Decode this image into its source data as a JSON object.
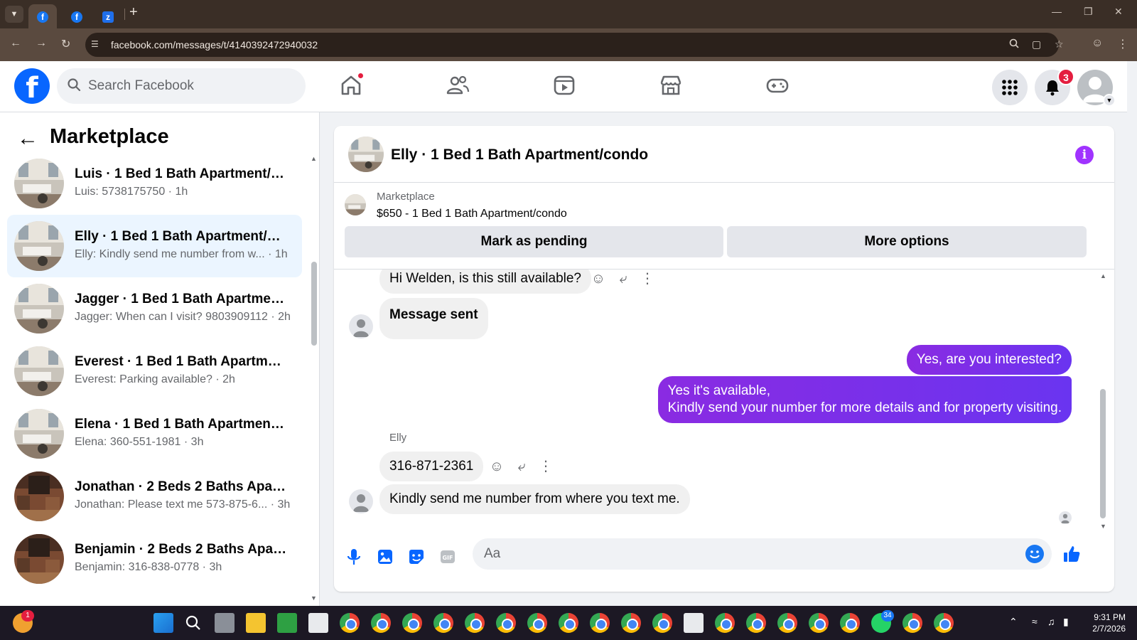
{
  "browser": {
    "url": "facebook.com/messages/t/4140392472940032"
  },
  "header": {
    "search_placeholder": "Search Facebook",
    "notification_count": "3"
  },
  "sidebar": {
    "title": "Marketplace",
    "conversations": [
      {
        "title": "Luis · 1 Bed 1 Bath Apartment/co...",
        "subtitle": "Luis: 5738175750 · 1h"
      },
      {
        "title": "Elly · 1 Bed 1 Bath Apartment/co...",
        "subtitle": "Elly: Kindly send me number from w... · 1h"
      },
      {
        "title": "Jagger · 1 Bed 1 Bath Apartment/...",
        "subtitle": "Jagger: When can I visit? 9803909112 · 2h"
      },
      {
        "title": "Everest · 1 Bed 1 Bath Apartment...",
        "subtitle": "Everest: Parking available? · 2h"
      },
      {
        "title": "Elena · 1 Bed 1 Bath Apartment/c...",
        "subtitle": "Elena: 360-551-1981 · 3h"
      },
      {
        "title": "Jonathan · 2 Beds 2 Baths Apart...",
        "subtitle": "Jonathan: Please text me 573-875-6... · 3h"
      },
      {
        "title": "Benjamin · 2 Beds 2 Baths Apart...",
        "subtitle": "Benjamin: 316-838-0778 · 3h"
      }
    ]
  },
  "chat": {
    "title": "Elly · 1 Bed 1 Bath Apartment/condo",
    "listing_source": "Marketplace",
    "listing_title": "$650 - 1 Bed 1 Bath Apartment/condo",
    "mark_pending_label": "Mark as pending",
    "more_options_label": "More options",
    "messages": {
      "m1": "Hi Welden, is this still available?",
      "m2": "Message sent",
      "m3": "Yes, are you interested?",
      "m4_line1": "Yes it's available,",
      "m4_line2": "Kindly send your number for more details and for property visiting.",
      "sender": "Elly",
      "m5": "316-871-2361",
      "m6": "Kindly send me number from where you text me."
    },
    "composer_placeholder": "Aa"
  },
  "taskbar": {
    "time": "9:31 PM",
    "date": "2/7/2026",
    "whatsapp_badge": "34",
    "weather_badge": "1"
  },
  "colors": {
    "facebook_blue": "#0866ff",
    "outgoing_bubble": "#7b2ff7",
    "notification_red": "#e41e3f"
  }
}
